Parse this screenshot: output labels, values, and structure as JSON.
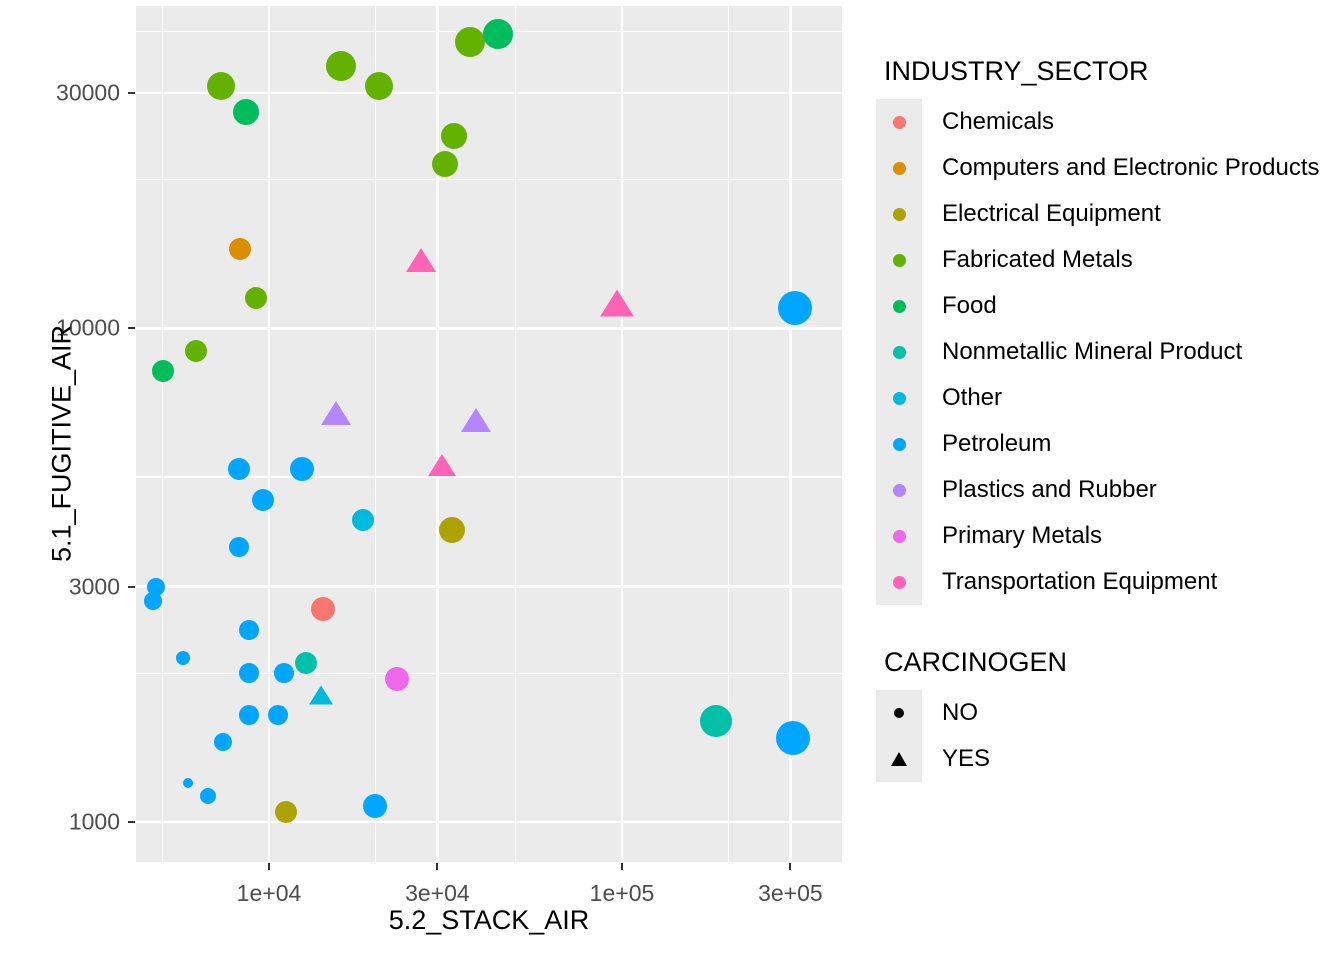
{
  "chart_data": {
    "type": "scatter",
    "title": "",
    "xlabel": "5.2_STACK_AIR",
    "ylabel": "5.1_FUGITIVE_AIR",
    "x_scale": "log",
    "y_scale": "log",
    "grid": true,
    "xticks": [
      "1e+04",
      "3e+04",
      "1e+05",
      "3e+05"
    ],
    "xtick_values": [
      10000,
      30000,
      100000,
      300000
    ],
    "yticks": [
      "30000",
      "10000",
      "3000",
      "1000"
    ],
    "ytick_values": [
      30000,
      10000,
      3000,
      1000
    ],
    "xlim": [
      4200,
      420000
    ],
    "ylim": [
      830,
      45000
    ],
    "legend_position": "right",
    "color_legend_title": "INDUSTRY_SECTOR",
    "shape_legend_title": "CARCINOGEN",
    "size_encodes": "total release magnitude",
    "points": [
      {
        "x": 16000,
        "y": 34000,
        "sector": "Fabricated Metals",
        "carcinogen": "NO",
        "r": 15
      },
      {
        "x": 37000,
        "y": 38000,
        "sector": "Fabricated Metals",
        "carcinogen": "NO",
        "r": 15
      },
      {
        "x": 44500,
        "y": 39500,
        "sector": "Food",
        "carcinogen": "NO",
        "r": 15
      },
      {
        "x": 7300,
        "y": 31000,
        "sector": "Fabricated Metals",
        "carcinogen": "NO",
        "r": 14
      },
      {
        "x": 20500,
        "y": 31000,
        "sector": "Fabricated Metals",
        "carcinogen": "NO",
        "r": 14
      },
      {
        "x": 8600,
        "y": 27500,
        "sector": "Food",
        "carcinogen": "NO",
        "r": 13
      },
      {
        "x": 33500,
        "y": 24500,
        "sector": "Fabricated Metals",
        "carcinogen": "NO",
        "r": 13
      },
      {
        "x": 31500,
        "y": 21500,
        "sector": "Fabricated Metals",
        "carcinogen": "NO",
        "r": 13
      },
      {
        "x": 8300,
        "y": 14500,
        "sector": "Computers and Electronic Products",
        "carcinogen": "NO",
        "r": 11
      },
      {
        "x": 9200,
        "y": 11500,
        "sector": "Fabricated Metals",
        "carcinogen": "NO",
        "r": 11
      },
      {
        "x": 27000,
        "y": 13500,
        "sector": "Transportation Equipment",
        "carcinogen": "YES",
        "r": 15
      },
      {
        "x": 97000,
        "y": 11000,
        "sector": "Transportation Equipment",
        "carcinogen": "YES",
        "r": 17
      },
      {
        "x": 310000,
        "y": 11000,
        "sector": "Petroleum",
        "carcinogen": "NO",
        "r": 17
      },
      {
        "x": 6200,
        "y": 9000,
        "sector": "Fabricated Metals",
        "carcinogen": "NO",
        "r": 11
      },
      {
        "x": 5000,
        "y": 8200,
        "sector": "Food",
        "carcinogen": "NO",
        "r": 11
      },
      {
        "x": 15500,
        "y": 6600,
        "sector": "Plastics and Rubber",
        "carcinogen": "YES",
        "r": 15
      },
      {
        "x": 38500,
        "y": 6400,
        "sector": "Plastics and Rubber",
        "carcinogen": "YES",
        "r": 15
      },
      {
        "x": 31000,
        "y": 5200,
        "sector": "Transportation Equipment",
        "carcinogen": "YES",
        "r": 14
      },
      {
        "x": 8200,
        "y": 5200,
        "sector": "Petroleum",
        "carcinogen": "NO",
        "r": 11
      },
      {
        "x": 12400,
        "y": 5200,
        "sector": "Petroleum",
        "carcinogen": "NO",
        "r": 12
      },
      {
        "x": 9600,
        "y": 4500,
        "sector": "Petroleum",
        "carcinogen": "NO",
        "r": 11
      },
      {
        "x": 18500,
        "y": 4100,
        "sector": "Other",
        "carcinogen": "NO",
        "r": 11
      },
      {
        "x": 33000,
        "y": 3900,
        "sector": "Electrical Equipment",
        "carcinogen": "NO",
        "r": 13
      },
      {
        "x": 8200,
        "y": 3600,
        "sector": "Petroleum",
        "carcinogen": "NO",
        "r": 10
      },
      {
        "x": 4800,
        "y": 3000,
        "sector": "Petroleum",
        "carcinogen": "NO",
        "r": 9
      },
      {
        "x": 4700,
        "y": 2800,
        "sector": "Petroleum",
        "carcinogen": "NO",
        "r": 9
      },
      {
        "x": 14200,
        "y": 2700,
        "sector": "Chemicals",
        "carcinogen": "NO",
        "r": 12
      },
      {
        "x": 8800,
        "y": 2450,
        "sector": "Petroleum",
        "carcinogen": "NO",
        "r": 10
      },
      {
        "x": 5700,
        "y": 2150,
        "sector": "Petroleum",
        "carcinogen": "NO",
        "r": 7
      },
      {
        "x": 8800,
        "y": 2000,
        "sector": "Petroleum",
        "carcinogen": "NO",
        "r": 10
      },
      {
        "x": 11000,
        "y": 2000,
        "sector": "Petroleum",
        "carcinogen": "NO",
        "r": 10
      },
      {
        "x": 12700,
        "y": 2100,
        "sector": "Nonmetallic Mineral Product",
        "carcinogen": "NO",
        "r": 11
      },
      {
        "x": 23000,
        "y": 1950,
        "sector": "Primary Metals",
        "carcinogen": "NO",
        "r": 12
      },
      {
        "x": 14000,
        "y": 1780,
        "sector": "Other",
        "carcinogen": "YES",
        "r": 12
      },
      {
        "x": 8800,
        "y": 1650,
        "sector": "Petroleum",
        "carcinogen": "NO",
        "r": 10
      },
      {
        "x": 10600,
        "y": 1650,
        "sector": "Petroleum",
        "carcinogen": "NO",
        "r": 10
      },
      {
        "x": 7400,
        "y": 1450,
        "sector": "Petroleum",
        "carcinogen": "NO",
        "r": 9
      },
      {
        "x": 5900,
        "y": 1200,
        "sector": "Petroleum",
        "carcinogen": "NO",
        "r": 5
      },
      {
        "x": 6700,
        "y": 1130,
        "sector": "Petroleum",
        "carcinogen": "NO",
        "r": 8
      },
      {
        "x": 11200,
        "y": 1050,
        "sector": "Electrical Equipment",
        "carcinogen": "NO",
        "r": 11
      },
      {
        "x": 20000,
        "y": 1080,
        "sector": "Petroleum",
        "carcinogen": "NO",
        "r": 12
      },
      {
        "x": 185000,
        "y": 1600,
        "sector": "Nonmetallic Mineral Product",
        "carcinogen": "NO",
        "r": 16
      },
      {
        "x": 305000,
        "y": 1480,
        "sector": "Petroleum",
        "carcinogen": "NO",
        "r": 17
      }
    ]
  },
  "color_legend": {
    "title": "INDUSTRY_SECTOR",
    "items": [
      {
        "label": "Chemicals",
        "color": "#F8766D"
      },
      {
        "label": "Computers and Electronic Products",
        "color": "#DB8E00"
      },
      {
        "label": "Electrical Equipment",
        "color": "#AEA200"
      },
      {
        "label": "Fabricated Metals",
        "color": "#64B200"
      },
      {
        "label": "Food",
        "color": "#00BD5C"
      },
      {
        "label": "Nonmetallic Mineral Product",
        "color": "#00C1A7"
      },
      {
        "label": "Other",
        "color": "#00BADE"
      },
      {
        "label": "Petroleum",
        "color": "#00A6FF"
      },
      {
        "label": "Plastics and Rubber",
        "color": "#B385FF"
      },
      {
        "label": "Primary Metals",
        "color": "#EF67EB"
      },
      {
        "label": "Transportation Equipment",
        "color": "#FF63B6"
      }
    ]
  },
  "shape_legend": {
    "title": "CARCINOGEN",
    "items": [
      {
        "label": "NO",
        "shape": "circle"
      },
      {
        "label": "YES",
        "shape": "triangle"
      }
    ]
  },
  "theme": {
    "panel_fill": "#EBEBEB",
    "grid_color": "#FFFFFF",
    "text_color": "#000000",
    "tick_text_color": "#4D4D4D"
  }
}
